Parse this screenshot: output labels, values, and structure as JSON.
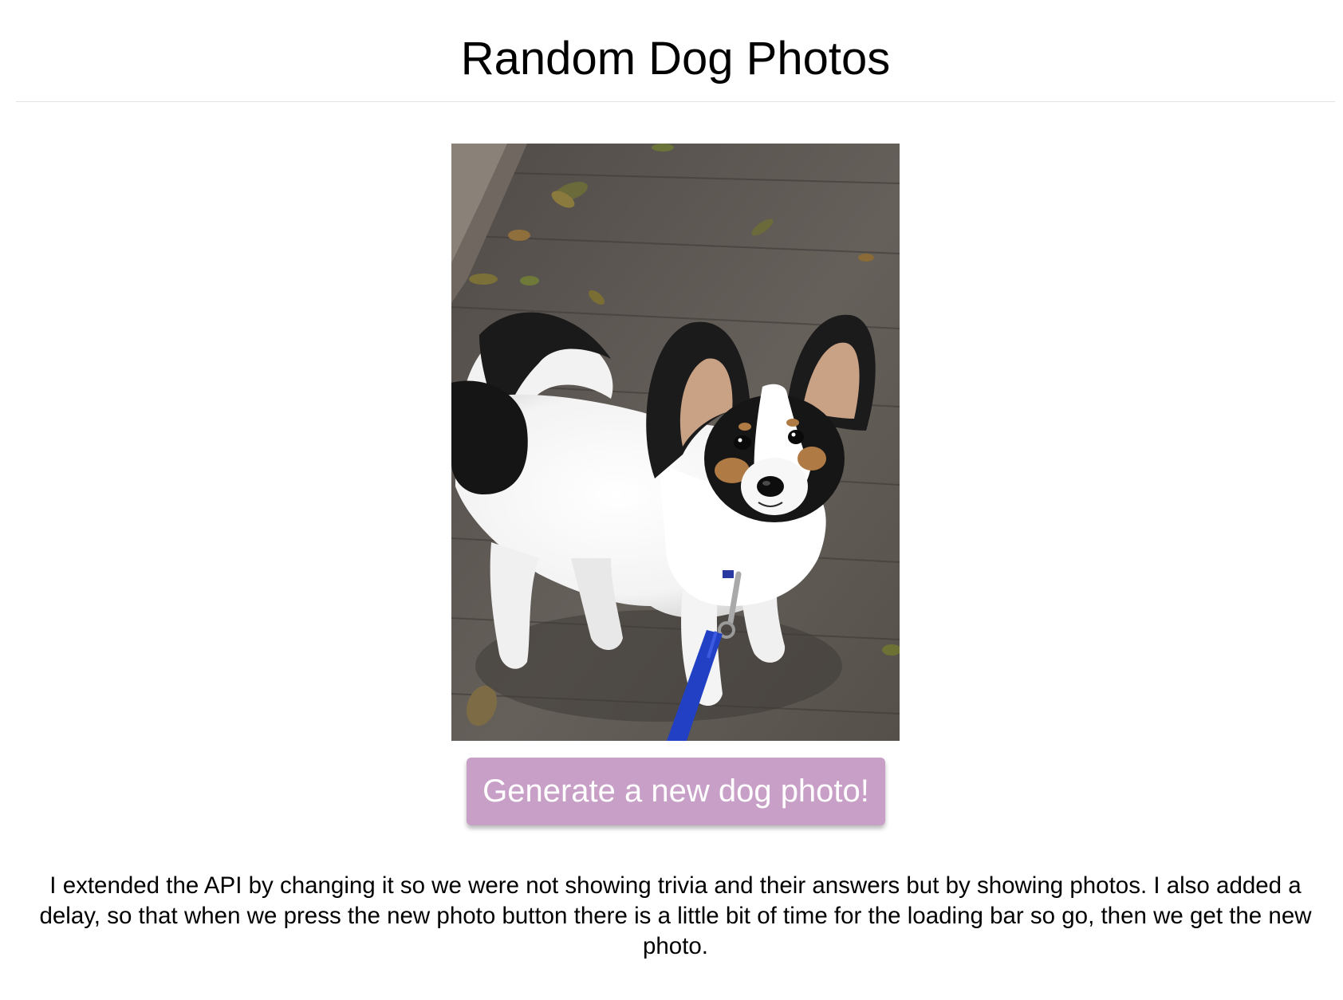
{
  "header": {
    "title": "Random Dog Photos"
  },
  "photo": {
    "alt": "",
    "icon": "dog-photo"
  },
  "actions": {
    "generate_label": "Generate a new dog photo!"
  },
  "description": {
    "text": "I extended the API by changing it so we were not showing trivia and their answers but by showing photos. I also added a delay, so that when we press the new photo button there is a little bit of time for the loading bar so go, then we get the new photo."
  },
  "colors": {
    "button_bg": "#c89fc6",
    "button_text": "#ffffff",
    "divider": "#e3e3e3"
  }
}
